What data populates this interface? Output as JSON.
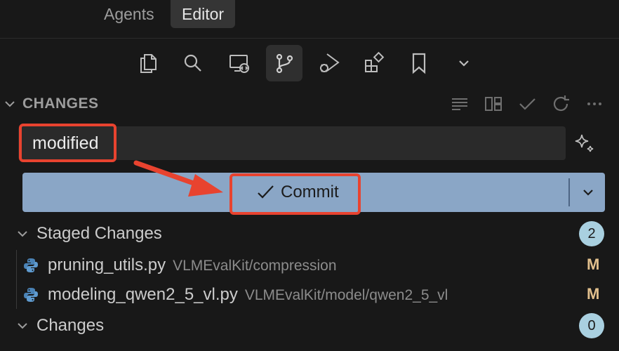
{
  "top_tabs": {
    "agents": "Agents",
    "editor": "Editor"
  },
  "toolbar": {
    "icons": [
      "files-icon",
      "search-icon",
      "remote-explorer-icon",
      "source-control-icon",
      "run-debug-icon",
      "extensions-icon",
      "bookmark-icon",
      "chevron-down-icon"
    ],
    "active": "source-control-icon"
  },
  "section": {
    "title": "CHANGES",
    "header_icons": [
      "list-view-icon",
      "split-view-icon",
      "check-icon",
      "refresh-icon",
      "more-icon"
    ]
  },
  "commit_message": {
    "value": "modified"
  },
  "commit_button": {
    "label": "Commit"
  },
  "staged": {
    "label": "Staged Changes",
    "count": "2",
    "files": [
      {
        "name": "pruning_utils.py",
        "path": "VLMEvalKit/compression",
        "status": "M"
      },
      {
        "name": "modeling_qwen2_5_vl.py",
        "path": "VLMEvalKit/model/qwen2_5_vl",
        "status": "M"
      }
    ]
  },
  "changes": {
    "label": "Changes",
    "count": "0"
  },
  "colors": {
    "commit_button": "#8aa6c6",
    "highlight": "#e8432f",
    "badge": "#a9d0e0",
    "modified": "#e2c08d"
  }
}
